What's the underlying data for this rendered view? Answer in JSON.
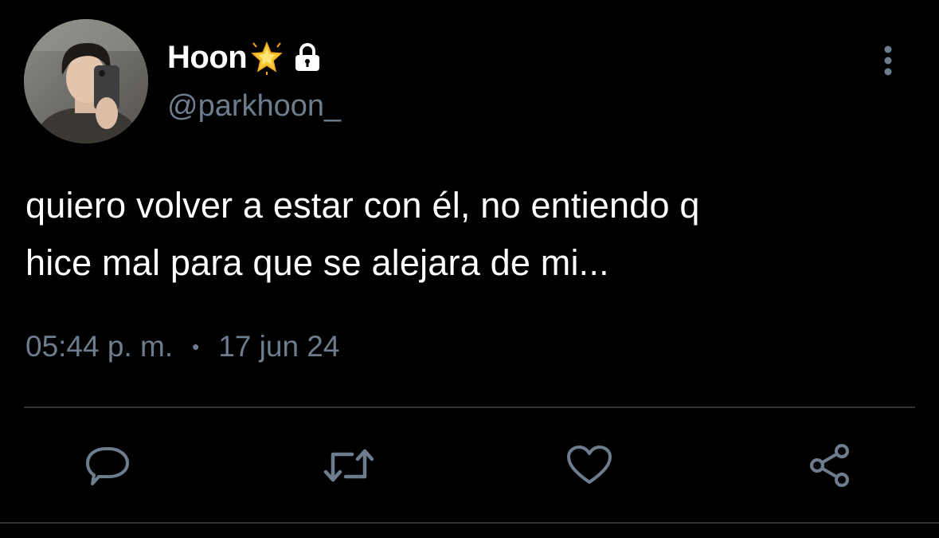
{
  "user": {
    "display_name": "Hoon",
    "handle": "@parkhoon_",
    "badge_icon": "glowing-star-icon",
    "protected_icon": "lock-icon"
  },
  "tweet": {
    "text_line1": "quiero volver a estar con él, no entiendo q",
    "text_line2": "hice mal para que se alejara de mi...",
    "time": "05:44 p. m.",
    "separator": "•",
    "date": "17 jun 24"
  },
  "actions": {
    "reply_icon": "speech-bubble-icon",
    "retweet_icon": "retweet-icon",
    "like_icon": "heart-icon",
    "share_icon": "share-icon"
  },
  "colors": {
    "background": "#000000",
    "text": "#ffffff",
    "secondary": "#6e7d8e",
    "divider": "#2f3336"
  }
}
